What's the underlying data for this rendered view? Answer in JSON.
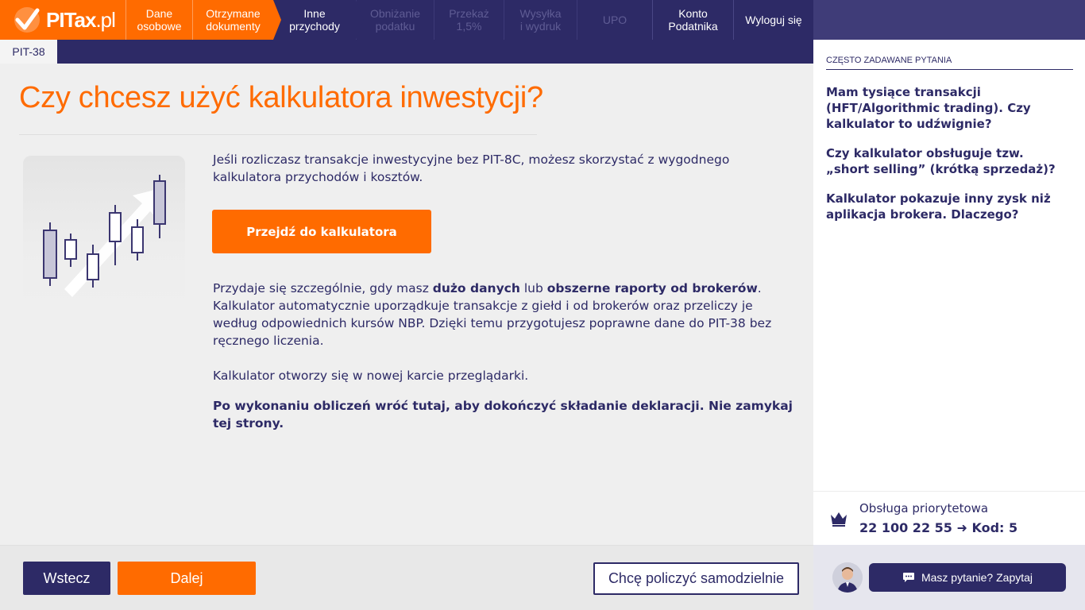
{
  "brand": {
    "logo_main": "PITax",
    "logo_suffix": ".pl"
  },
  "nav": {
    "steps": [
      {
        "label": "Dane\nosobowe",
        "state": "done"
      },
      {
        "label": "Otrzymane\ndokumenty",
        "state": "done"
      },
      {
        "label": "Inne\nprzychody",
        "state": "active"
      },
      {
        "label": "Obniżanie\npodatku",
        "state": "todo"
      },
      {
        "label": "Przekaż\n1,5%",
        "state": "todo"
      },
      {
        "label": "Wysyłka\ni wydruk",
        "state": "todo"
      },
      {
        "label": "UPO",
        "state": "todo"
      }
    ],
    "account_label": "Konto\nPodatnika",
    "logout_label": "Wyloguj się"
  },
  "tabs": {
    "active_tab": "PIT-38"
  },
  "main": {
    "title": "Czy chcesz użyć kalkulatora inwestycji?",
    "intro": "Jeśli rozliczasz transakcje inwestycyjne bez PIT-8C, możesz skorzystać z wygodnego kalkulatora przychodów i kosztów.",
    "calc_button": "Przejdź do kalkulatora",
    "para2_a": "Przydaje się szczególnie, gdy masz ",
    "para2_b": "dużo danych",
    "para2_c": " lub ",
    "para2_d": "obszerne raporty od brokerów",
    "para2_e": ". Kalkulator automatycznie  uporządkuje transakcje z giełd i od brokerów oraz przeliczy je według odpowiednich kursów NBP.  Dzięki temu przygotujesz poprawne dane do PIT-38 bez ręcznego liczenia.",
    "para3": "Kalkulator otworzy się w nowej karcie przeglądarki.",
    "para4": "Po wykonaniu obliczeń wróć tutaj, aby dokończyć składanie deklaracji. Nie zamykaj tej strony."
  },
  "footer": {
    "back_label": "Wstecz",
    "next_label": "Dalej",
    "self_label": "Chcę policzyć samodzielnie"
  },
  "sidebar": {
    "faq_heading": "CZĘSTO ZADAWANE PYTANIA",
    "faq": [
      "Mam tysiące transakcji (HFT/Algorithmic trading). Czy kalkulator to udźwignie?",
      "Czy kalkulator obsługuje tzw. „short selling” (krótką sprzedaż)?",
      "Kalkulator pokazuje inny zysk niż aplikacja brokera. Dlaczego?"
    ],
    "priority_label": "Obsługa priorytetowa",
    "priority_phone": "22 100 22 55 ➜ Kod: 5",
    "chat_label": "Masz pytanie? Zapytaj"
  },
  "colors": {
    "brand_orange": "#ff6b00",
    "navy": "#2d2a66"
  },
  "icons": {
    "logo": "checkmark-logo-icon",
    "illustration": "candlestick-chart-icon",
    "crown": "crown-icon",
    "chat": "chat-bubble-icon",
    "avatar": "advisor-avatar-icon"
  }
}
